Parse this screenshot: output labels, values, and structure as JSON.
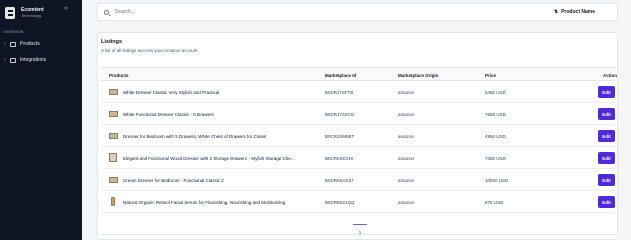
{
  "sidebar": {
    "brand_name": "Ecomtent",
    "brand_sub": "Technology",
    "collapse_icon": "double-chevron-left-icon",
    "section_label": "OVERVIEW",
    "items": [
      {
        "label": "Products",
        "icon": "box-icon"
      },
      {
        "label": "Integrations",
        "icon": "plug-icon"
      }
    ]
  },
  "topbar": {
    "search_placeholder": "Search...",
    "filter_label": "Product Name"
  },
  "listings": {
    "title": "Listings",
    "subtitle": "A list of all listings accross your Amazon account.",
    "columns": [
      "Products",
      "Marketplace Id",
      "Marketplace Origin",
      "Price",
      "Action"
    ],
    "rows": [
      {
        "name": "White Dresser Classic Very Stylish and Practical",
        "id": "B0CRJY5FTB",
        "origin": "amazon",
        "price": "5450 USD",
        "action": "Edit",
        "thumb": "dresser"
      },
      {
        "name": "White Functional Dresser Classic - 6 Drawers",
        "id": "B0CRJY2ZCG",
        "origin": "amazon",
        "price": "7550 USD",
        "action": "Edit",
        "thumb": "dresser"
      },
      {
        "name": "Dresser for Bedroom with 5 Drawers, White Chest of Drawers for Closet",
        "id": "B0CRJXM6BT",
        "origin": "amazon",
        "price": "4950 USD",
        "action": "Edit",
        "thumb": "dresser"
      },
      {
        "name": "Elegant and Functional Wood Dresser with 2 Storage Drawers - Stylish Storage Che...",
        "id": "B0CRK5DJ1K",
        "origin": "amazon",
        "price": "7350 USD",
        "action": "Edit",
        "thumb": "tall"
      },
      {
        "name": "Cream Dresser for Bedroom - Functional Classic 2",
        "id": "B0CRK5AK57",
        "origin": "amazon",
        "price": "10000 USD",
        "action": "Edit",
        "thumb": "dresser"
      },
      {
        "name": "Natural Organic Retinol Facial Serum for Flourishing, Nourishing and Moisturizing",
        "id": "B0CRB921QQ",
        "origin": "amazon",
        "price": "675 USD",
        "action": "Edit",
        "thumb": "bottle"
      }
    ]
  },
  "pagination": {
    "current_page": "1"
  },
  "colors": {
    "sidebar_bg": "#0f1525",
    "accent": "#4f2bd9"
  }
}
